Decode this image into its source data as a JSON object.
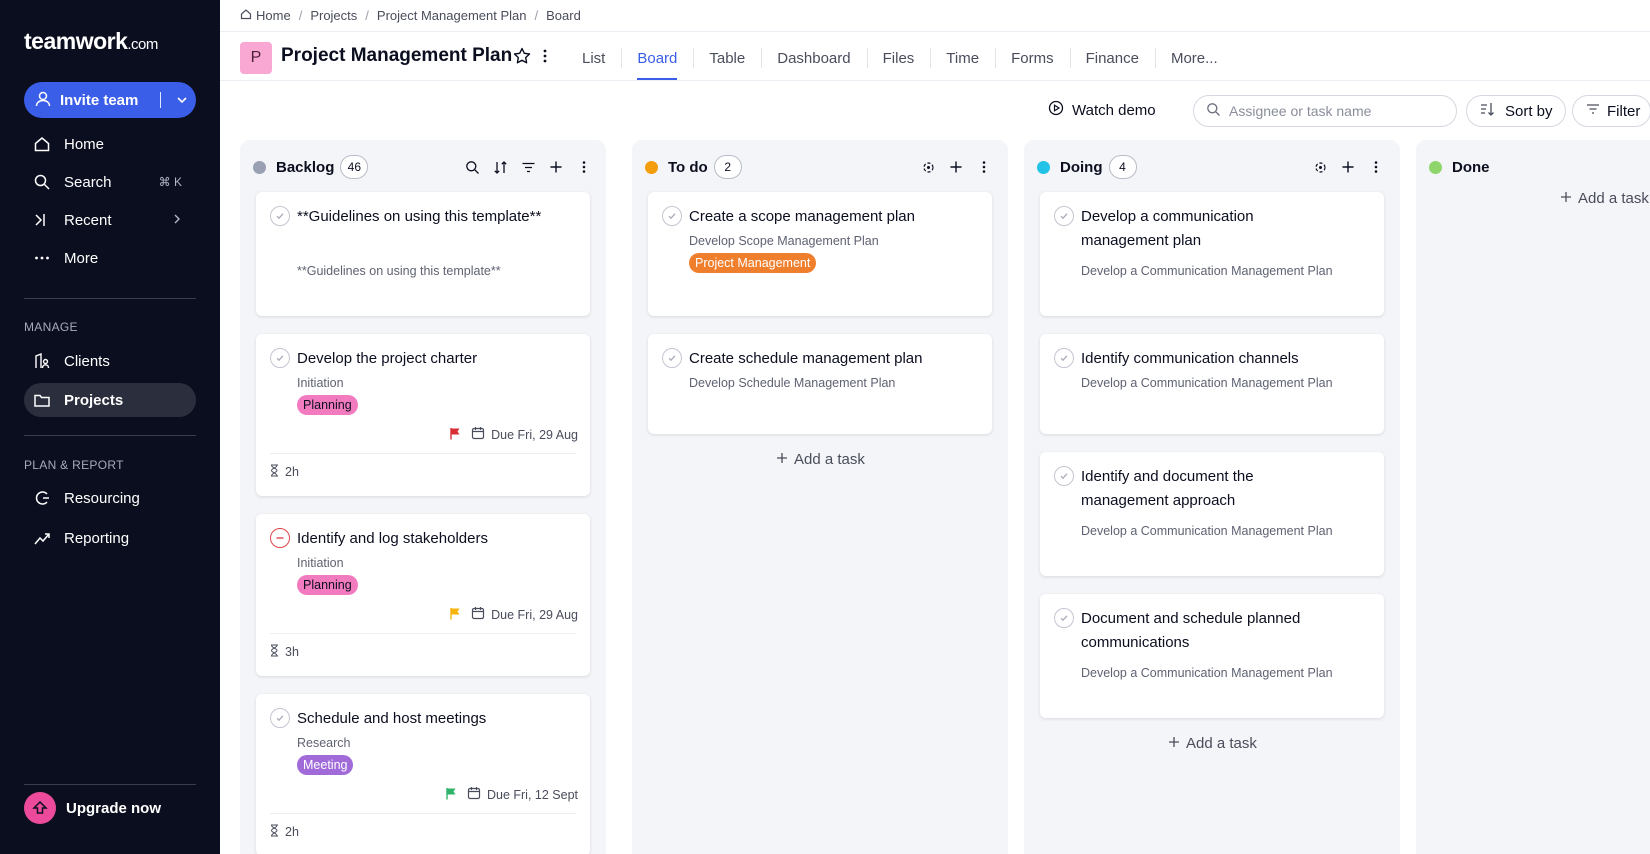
{
  "sidebar": {
    "brand": "teamwork",
    "brand_suffix": ".com",
    "invite_label": "Invite team",
    "nav": [
      {
        "label": "Home",
        "icon": "home-icon"
      },
      {
        "label": "Search",
        "icon": "search-icon",
        "shortcut": "⌘ K"
      },
      {
        "label": "Recent",
        "icon": "recent-icon"
      },
      {
        "label": "More",
        "icon": "more-icon"
      }
    ],
    "manage_label": "MANAGE",
    "manage": [
      {
        "label": "Clients",
        "icon": "clients-icon"
      },
      {
        "label": "Projects",
        "icon": "folder-icon"
      }
    ],
    "plan_label": "PLAN & REPORT",
    "plan": [
      {
        "label": "Resourcing",
        "icon": "resourcing-icon"
      },
      {
        "label": "Reporting",
        "icon": "reporting-icon"
      }
    ],
    "upgrade_label": "Upgrade now"
  },
  "breadcrumb": [
    "Home",
    "Projects",
    "Project Management Plan",
    "Board"
  ],
  "project": {
    "initial": "P",
    "title": "Project Management Plan"
  },
  "tabs": [
    "List",
    "Board",
    "Table",
    "Dashboard",
    "Files",
    "Time",
    "Forms",
    "Finance",
    "More..."
  ],
  "active_tab": "Board",
  "toolbar": {
    "watch_demo": "Watch demo",
    "search_placeholder": "Assignee or task name",
    "sort_label": "Sort by",
    "filter_label": "Filter"
  },
  "colors": {
    "accent": "#3b5ee8",
    "backlog": "#9aa0b4",
    "todo": "#f59e0b",
    "doing": "#22c3e6",
    "done": "#8ed66b"
  },
  "columns": {
    "backlog": {
      "title": "Backlog",
      "count": "46",
      "cards": [
        {
          "title": "**Guidelines on using this template**",
          "sub": "**Guidelines on using this template**"
        },
        {
          "title": "Develop the project charter",
          "sub": "Initiation",
          "tag": "Planning",
          "due": "Due Fri, 29 Aug",
          "flag": "#d92d36",
          "estimate": "2h"
        },
        {
          "title": "Identify and log stakeholders",
          "sub": "Initiation",
          "tag": "Planning",
          "due": "Due Fri, 29 Aug",
          "flag": "#f5b50a",
          "estimate": "3h"
        },
        {
          "title": "Schedule and host meetings",
          "sub": "Research",
          "tag": "Meeting",
          "due": "Due Fri, 12 Sept",
          "flag": "#2fb36b",
          "estimate": "2h"
        }
      ]
    },
    "todo": {
      "title": "To do",
      "count": "2",
      "cards": [
        {
          "title": "Create a scope management plan",
          "sub": "Develop Scope Management Plan",
          "tag": "Project Management"
        },
        {
          "title": "Create schedule management plan",
          "sub": "Develop Schedule Management Plan"
        }
      ],
      "add_task": "Add a task"
    },
    "doing": {
      "title": "Doing",
      "count": "4",
      "cards": [
        {
          "title": "Develop a communication management plan",
          "sub": "Develop a Communication Management Plan"
        },
        {
          "title": "Identify communication channels",
          "sub": "Develop a Communication Management Plan"
        },
        {
          "title": "Identify and document the management approach",
          "sub": "Develop a Communication Management Plan"
        },
        {
          "title": "Document and schedule planned communications",
          "sub": "Develop a Communication Management Plan"
        }
      ],
      "add_task": "Add a task"
    },
    "done": {
      "title": "Done",
      "add_task": "Add a task"
    }
  }
}
